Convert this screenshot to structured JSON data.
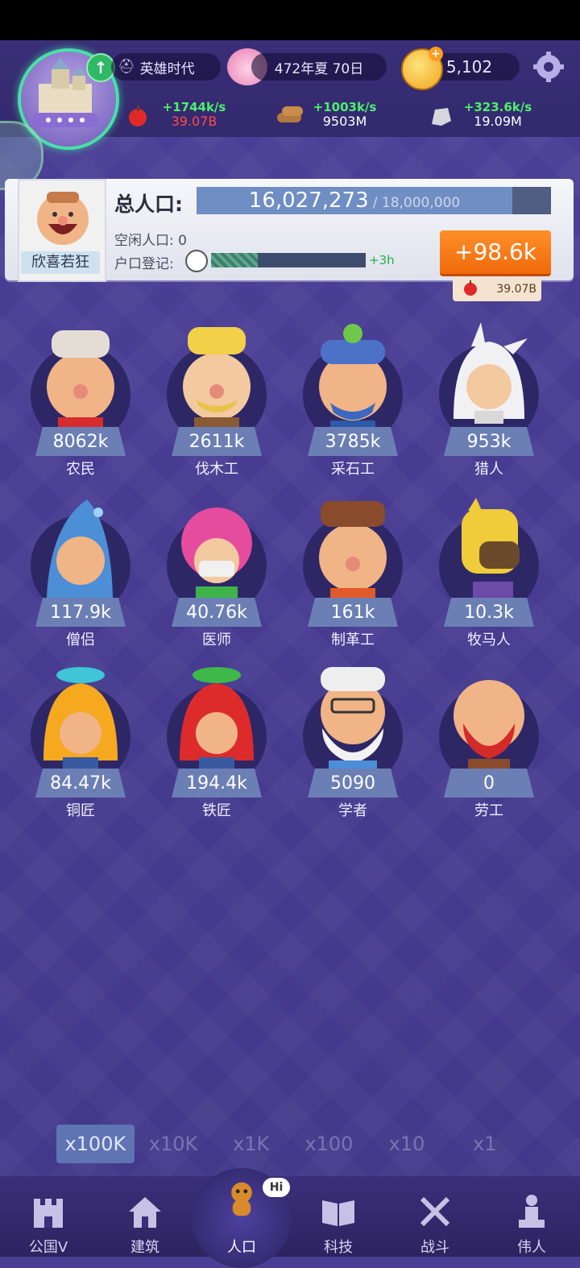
{
  "header": {
    "era": "英雄时代",
    "date": "472年夏 70日",
    "gold": "5,102",
    "resources": [
      {
        "name": "food",
        "rate": "+1744k/s",
        "amount": "39.07B",
        "amount_color": "#ff4b4b"
      },
      {
        "name": "wood",
        "rate": "+1003k/s",
        "amount": "9503M",
        "amount_color": "#ffffff"
      },
      {
        "name": "stone",
        "rate": "+323.6k/s",
        "amount": "19.09M",
        "amount_color": "#ffffff"
      }
    ]
  },
  "population": {
    "label": "总人口:",
    "current": "16,027,273",
    "max": "/ 18,000,000",
    "fill_fraction": 0.89,
    "mood": "欣喜若狂",
    "idle": "空闲人口: 0",
    "registration_label": "户口登记:",
    "registration_fraction": 0.3,
    "registration_bonus": "+3h",
    "boost": "+98.6k",
    "boost_cost": "39.07B"
  },
  "characters": [
    {
      "name": "农民",
      "count": "8062k",
      "icon": "farmer"
    },
    {
      "name": "伐木工",
      "count": "2611k",
      "icon": "lumberjack"
    },
    {
      "name": "采石工",
      "count": "3785k",
      "icon": "quarryman"
    },
    {
      "name": "猎人",
      "count": "953k",
      "icon": "hunter"
    },
    {
      "name": "僧侣",
      "count": "117.9k",
      "icon": "monk"
    },
    {
      "name": "医师",
      "count": "40.76k",
      "icon": "doctor"
    },
    {
      "name": "制革工",
      "count": "161k",
      "icon": "tanner"
    },
    {
      "name": "牧马人",
      "count": "10.3k",
      "icon": "horse-herder"
    },
    {
      "name": "铜匠",
      "count": "84.47k",
      "icon": "coppersmith"
    },
    {
      "name": "铁匠",
      "count": "194.4k",
      "icon": "blacksmith"
    },
    {
      "name": "学者",
      "count": "5090",
      "icon": "scholar"
    },
    {
      "name": "劳工",
      "count": "0",
      "icon": "laborer"
    }
  ],
  "multipliers": [
    "x100K",
    "x10K",
    "x1K",
    "x100",
    "x10",
    "x1"
  ],
  "active_multiplier": "x100K",
  "nav": [
    {
      "label": "公国V",
      "icon": "castle-icon"
    },
    {
      "label": "建筑",
      "icon": "house-icon"
    },
    {
      "label": "人口",
      "icon": "person-icon"
    },
    {
      "label": "科技",
      "icon": "book-icon"
    },
    {
      "label": "战斗",
      "icon": "swords-icon"
    },
    {
      "label": "伟人",
      "icon": "statue-icon"
    }
  ],
  "active_nav": "人口",
  "nav_bubble": "Hi",
  "colors": {
    "accent": "#f06a0a",
    "rate_green": "#4cf06a",
    "panel": "#f6f7fb",
    "background": "#4b3f97"
  }
}
